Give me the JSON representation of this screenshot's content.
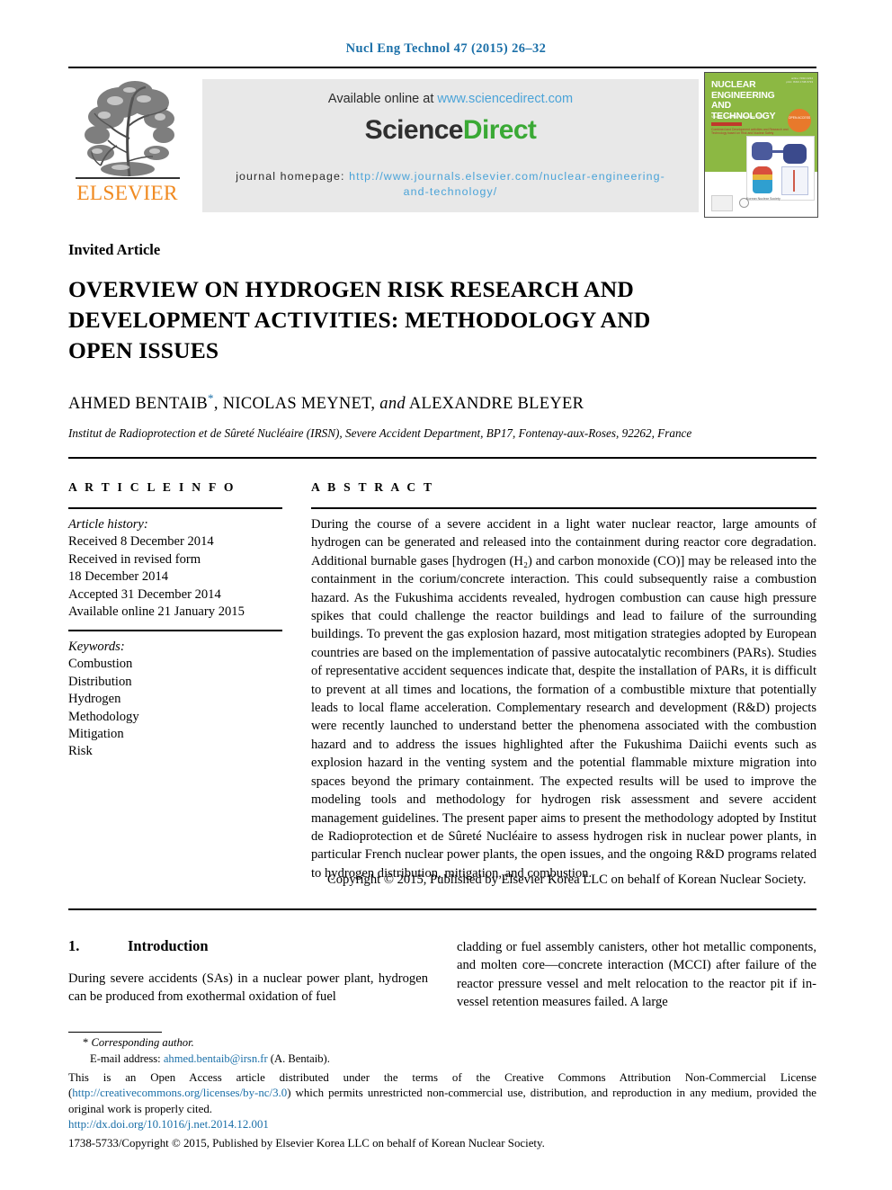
{
  "running_head": "Nucl Eng Technol 47 (2015) 26–32",
  "header": {
    "available_prefix": "Available online at ",
    "available_link": "www.sciencedirect.com",
    "sciencedirect_part1": "Science",
    "sciencedirect_part2": "Direct",
    "homepage_label": "journal homepage: ",
    "homepage_link_line1": "http://www.journals.elsevier.com/nuclear-",
    "homepage_link_line2": "engineering-and-technology/",
    "publisher_logo_text": "ELSEVIER",
    "publisher_logo_icon": "elsevier-tree-icon",
    "accent_link_color": "#4aa3d8",
    "sciencedirect_green": "#3aa935",
    "elsevier_orange": "#f08a21",
    "running_head_color": "#1a6fa8"
  },
  "cover": {
    "title": "NUCLEAR ENGINEERING AND TECHNOLOGY",
    "volume_line": "Volume 47  Number 1  February 2015",
    "corner_line": "online: ISSN 2234 print: ISSN 1738-5733",
    "badge_text": "OPEN ACCESS",
    "highlight_bar": "IN THIS ISSUE",
    "highlight_text": "Combined and Development activities and Research and Technology based on Risk and Nuclear Safety",
    "background_color": "#8cb843",
    "society_text": "Korean Nuclear Society"
  },
  "article": {
    "type_label": "Invited Article",
    "title": "OVERVIEW ON HYDROGEN RISK RESEARCH AND DEVELOPMENT ACTIVITIES: METHODOLOGY AND OPEN ISSUES",
    "authors_part1": "AHMED BENTAIB",
    "authors_star": "*",
    "authors_part2": ", NICOLAS MEYNET, ",
    "authors_and": "and",
    "authors_part3": " ALEXANDRE BLEYER",
    "affiliation": "Institut de Radioprotection et de Sûreté Nucléaire (IRSN), Severe Accident Department, BP17, Fontenay-aux-Roses, 92262, France"
  },
  "article_info": {
    "heading": "A R T I C L E   I N F O",
    "history_label": "Article history:",
    "history_lines": [
      "Received 8 December 2014",
      "Received in revised form",
      "18 December 2014",
      "Accepted 31 December 2014",
      "Available online 21 January 2015"
    ],
    "keywords_label": "Keywords:",
    "keywords": [
      "Combustion",
      "Distribution",
      "Hydrogen",
      "Methodology",
      "Mitigation",
      "Risk"
    ]
  },
  "abstract": {
    "heading": "A B S T R A C T",
    "body": "During the course of a severe accident in a light water nuclear reactor, large amounts of hydrogen can be generated and released into the containment during reactor core degradation. Additional burnable gases [hydrogen (H₂) and carbon monoxide (CO)] may be released into the containment in the corium/concrete interaction. This could subsequently raise a combustion hazard. As the Fukushima accidents revealed, hydrogen combustion can cause high pressure spikes that could challenge the reactor buildings and lead to failure of the surrounding buildings. To prevent the gas explosion hazard, most mitigation strategies adopted by European countries are based on the implementation of passive autocatalytic recombiners (PARs). Studies of representative accident sequences indicate that, despite the installation of PARs, it is difficult to prevent at all times and locations, the formation of a combustible mixture that potentially leads to local flame acceleration. Complementary research and development (R&D) projects were recently launched to understand better the phenomena associated with the combustion hazard and to address the issues highlighted after the Fukushima Daiichi events such as explosion hazard in the venting system and the potential flammable mixture migration into spaces beyond the primary containment. The expected results will be used to improve the modeling tools and methodology for hydrogen risk assessment and severe accident management guidelines. The present paper aims to present the methodology adopted by Institut de Radioprotection et de Sûreté Nucléaire to assess hydrogen risk in nuclear power plants, in particular French nuclear power plants, the open issues, and the ongoing R&D programs related to hydrogen distribution, mitigation, and combustion.",
    "copyright": "Copyright © 2015, Published by Elsevier Korea LLC on behalf of Korean Nuclear Society."
  },
  "introduction": {
    "number": "1.",
    "title": "Introduction",
    "column_left": "During severe accidents (SAs) in a nuclear power plant, hydrogen can be produced from exothermal oxidation of fuel",
    "column_right": "cladding or fuel assembly canisters, other hot metallic components, and molten core—concrete interaction (MCCI) after failure of the reactor pressure vessel and melt relocation to the reactor pit if in-vessel retention measures failed. A large"
  },
  "footnotes": {
    "corresponding_mark": "*",
    "corresponding_label": "Corresponding author.",
    "email_label": "E-mail address: ",
    "email_link": "ahmed.bentaib@irsn.fr",
    "email_suffix": " (A. Bentaib).",
    "license_part1": "This is an Open Access article distributed under the terms of the Creative Commons Attribution Non-Commercial License (",
    "license_link": "http://creativecommons.org/licenses/by-nc/3.0",
    "license_part2": ") which permits unrestricted non-commercial use, distribution, and reproduction in any medium, provided the original work is properly cited.",
    "doi": "http://dx.doi.org/10.1016/j.net.2014.12.001",
    "issn_line": "1738-5733/Copyright © 2015, Published by Elsevier Korea LLC on behalf of Korean Nuclear Society."
  }
}
